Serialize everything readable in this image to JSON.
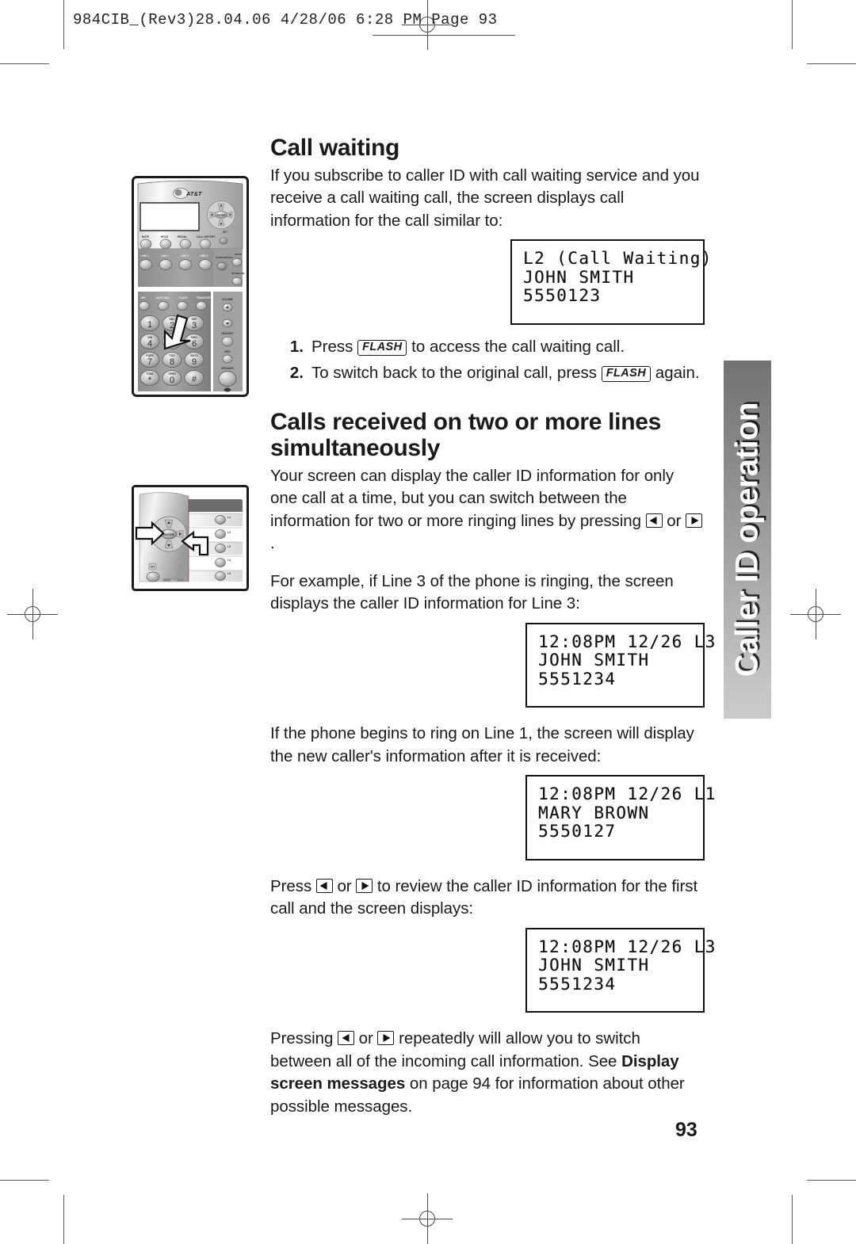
{
  "prepress": {
    "slug": "984CIB_(Rev3)28.04.06  4/28/06  6:28 PM  Page 93"
  },
  "side_tab": {
    "label": "Caller ID operation",
    "gradient_top": "#727272",
    "gradient_bottom": "#cacaca",
    "text_color": "#ffffff"
  },
  "page_number": "93",
  "sections": [
    {
      "heading": "Call waiting",
      "intro": "If you subscribe to caller ID with call waiting service and you receive a call waiting call, the screen displays call information for the call similar to:",
      "lcd": {
        "line1": "L2 (Call Waiting)",
        "line2": "JOHN SMITH",
        "line3": "5550123"
      },
      "steps": [
        {
          "num": "1.",
          "pre": "Press ",
          "key": "FLASH",
          "post": " to access the call waiting call."
        },
        {
          "num": "2.",
          "pre": "To switch back to the original call, press ",
          "key": "FLASH",
          "post": " again."
        }
      ]
    },
    {
      "heading": "Calls received on two or more lines simultaneously",
      "para1_a": "Your screen can display the caller ID information for only one call at a time, but you can switch between the information for two or more ringing lines by pressing ",
      "para1_or": " or ",
      "para1_end": ".",
      "para2": "For example, if Line 3 of the phone is ringing, the screen displays the caller ID information for Line 3:",
      "lcd_line3": {
        "line1": "12:08PM 12/26 L3",
        "line2": "JOHN SMITH",
        "line3": "5551234"
      },
      "para3": "If the phone begins to ring on Line 1, the screen will display the new caller's information after it is received:",
      "lcd_line1": {
        "line1": "12:08PM 12/26 L1",
        "line2": "MARY BROWN",
        "line3": "5550127"
      },
      "para4_a": "Press ",
      "para4_or": " or ",
      "para4_b": " to review the caller ID information for the first call and the screen displays:",
      "lcd_first": {
        "line1": "12:08PM 12/26 L3",
        "line2": "JOHN SMITH",
        "line3": "5551234"
      },
      "para5_a": "Pressing ",
      "para5_or": " or ",
      "para5_b": " repeatedly will allow you to switch between all of the incoming call information.  See ",
      "para5_bold": "Display screen messages",
      "para5_c": " on page 94 for information about other possible messages."
    }
  ],
  "illustrations": {
    "phone": {
      "name": "corded-telephone-base",
      "brand_logo": "AT&T",
      "highlight_key": "FLASH",
      "keypad": [
        [
          "1",
          "2",
          "3"
        ],
        [
          "4",
          "5",
          "6"
        ],
        [
          "7",
          "8",
          "9"
        ],
        [
          "*",
          "0",
          "#"
        ]
      ],
      "keypad_letters": [
        [
          "",
          "ABC",
          "DEF"
        ],
        [
          "GHI",
          "JKL",
          "MNO"
        ],
        [
          "PQRS",
          "TUV",
          "WXYZ"
        ],
        [
          "TONE",
          "OPER",
          ""
        ]
      ],
      "feature_row1": [
        "MUTE",
        "HOLD",
        "REDIAL",
        "CALL HISTORY"
      ],
      "feature_row2": [
        "LINE 1",
        "LINE 2",
        "LINE 3",
        "LINE 4"
      ],
      "feature_row3": [
        "DIR",
        "AUTO DIAL",
        "FLASH",
        "TRANSFER"
      ],
      "side_labels": [
        "DROP",
        "INTERCOM",
        "VOLUME",
        "HEADSET",
        "MSG",
        "SPEAKER"
      ],
      "nav_center": "ENTER"
    },
    "navpad": {
      "name": "navigation-keys-closeup",
      "nav_center": "ENTER",
      "line_labels": [
        "L1",
        "L2",
        "L3",
        "L4",
        "L5"
      ],
      "arrow_callouts": [
        "left-arrow-key",
        "right-arrow-key"
      ]
    }
  }
}
